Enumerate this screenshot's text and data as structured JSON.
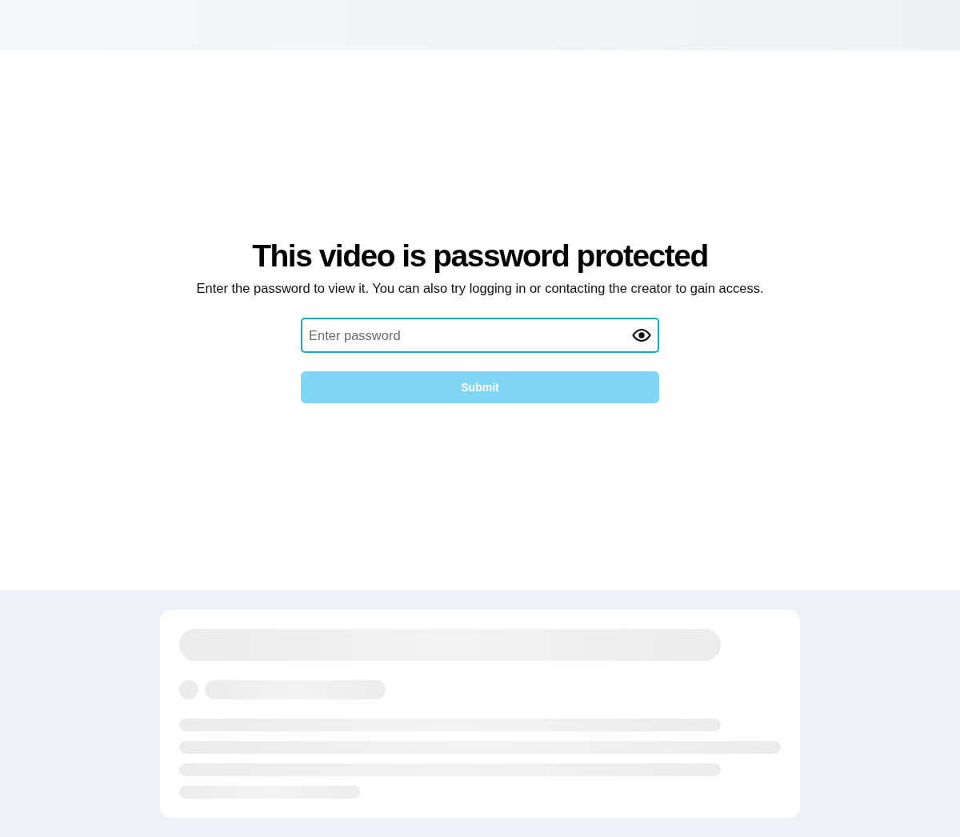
{
  "title": "This video is password protected",
  "message": "Enter the password to view it. You can also try logging in or contacting the creator to gain access.",
  "password_field": {
    "placeholder": "Enter password"
  },
  "submit_button": {
    "label": "Submit",
    "disabled": true
  }
}
